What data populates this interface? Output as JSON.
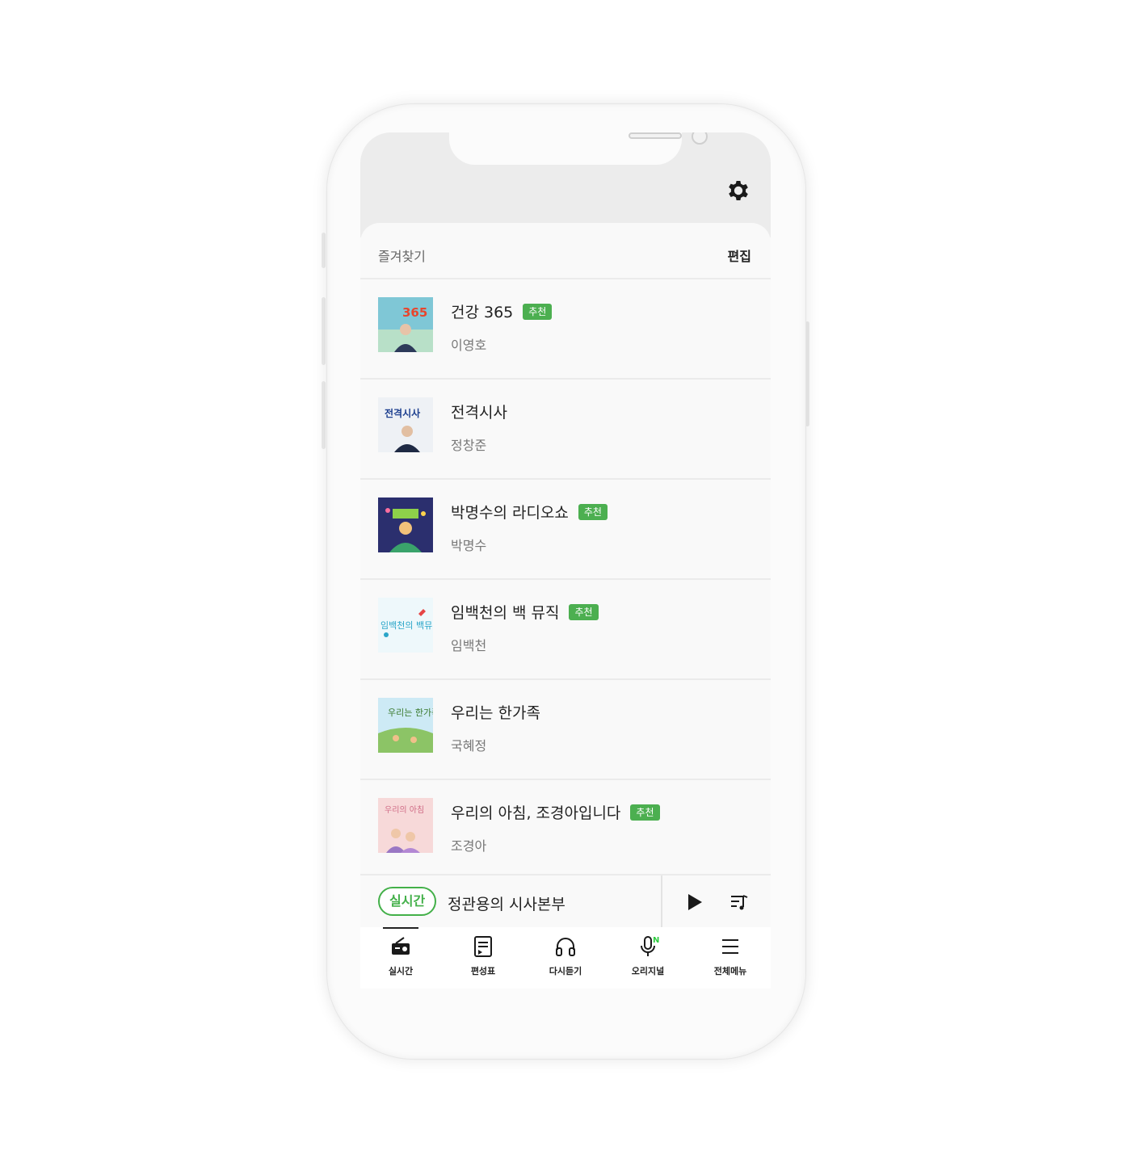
{
  "header": {
    "settings_icon": "gear-icon"
  },
  "favorites": {
    "title": "즐겨찾기",
    "edit_label": "편집",
    "items": [
      {
        "title": "건강 365",
        "badge": "추천",
        "host": "이영호"
      },
      {
        "title": "전격시사",
        "badge": "",
        "host": "정창준"
      },
      {
        "title": "박명수의 라디오쇼",
        "badge": "추천",
        "host": "박명수"
      },
      {
        "title": "임백천의 백 뮤직",
        "badge": "추천",
        "host": "임백천"
      },
      {
        "title": "우리는 한가족",
        "badge": "",
        "host": "국혜정"
      },
      {
        "title": "우리의 아침, 조경아입니다",
        "badge": "추천",
        "host": "조경아"
      }
    ]
  },
  "player": {
    "live_label": "실시간",
    "now_playing": "정관용의 시사본부",
    "play_icon": "play-icon",
    "playlist_icon": "playlist-icon"
  },
  "tabs": [
    {
      "label": "실시간",
      "icon": "radio-icon",
      "active": true
    },
    {
      "label": "편성표",
      "icon": "schedule-icon"
    },
    {
      "label": "다시듣기",
      "icon": "headphones-icon"
    },
    {
      "label": "오리지널",
      "icon": "microphone-icon",
      "badge": "N"
    },
    {
      "label": "전체메뉴",
      "icon": "menu-icon"
    }
  ],
  "colors": {
    "accent": "#4caf50",
    "live_border": "#43b049",
    "new_badge": "#2ecc40"
  }
}
